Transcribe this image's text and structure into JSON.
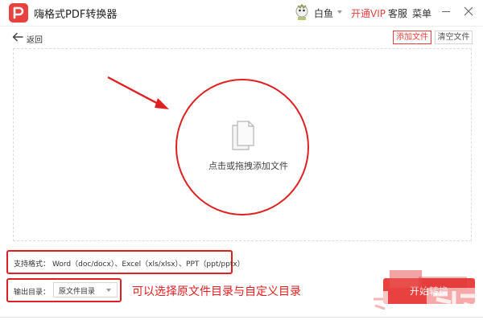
{
  "app": {
    "title": "嗨格式PDF转换器",
    "accent_color": "#e8413f"
  },
  "header": {
    "user_name": "白鱼",
    "vip_label": "开通VIP",
    "service_label": "客服",
    "menu_label": "菜单"
  },
  "toolbar": {
    "back_label": "返回",
    "add_file_label": "添加文件",
    "clear_file_label": "清空文件"
  },
  "drop_area": {
    "hint": "点击或拖拽添加文件",
    "icon": "files-icon"
  },
  "formats": {
    "label": "支持格式：",
    "value": "Word（doc/docx）、Excel（xls/xlsx）、PPT（ppt/pptx）"
  },
  "output": {
    "label": "输出目录：",
    "selected": "原文件目录"
  },
  "annotation": {
    "text": "可以选择原文件目录与自定义目录",
    "color": "#e02020"
  },
  "start_button": {
    "label": "开始转换"
  }
}
